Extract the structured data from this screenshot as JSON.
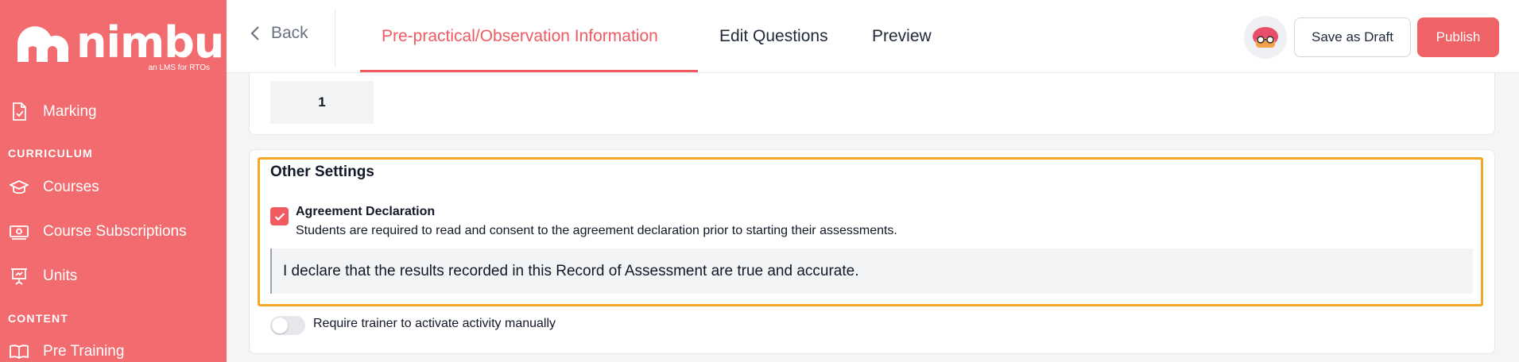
{
  "sidebar": {
    "logo_text": "nimbu",
    "logo_tagline": "an LMS for RTOs",
    "items_top": [
      {
        "label": "Marking",
        "icon": "document-check-icon"
      }
    ],
    "sections": [
      {
        "label": "CURRICULUM",
        "items": [
          {
            "label": "Courses",
            "icon": "graduation-cap-icon"
          },
          {
            "label": "Course Subscriptions",
            "icon": "money-icon"
          },
          {
            "label": "Units",
            "icon": "presentation-board-icon"
          }
        ]
      },
      {
        "label": "CONTENT",
        "items": [
          {
            "label": "Pre Training",
            "icon": "book-open-icon"
          }
        ]
      }
    ]
  },
  "header": {
    "back_label": "Back",
    "tabs": [
      {
        "label": "Pre-practical/Observation Information",
        "active": true
      },
      {
        "label": "Edit Questions",
        "active": false
      },
      {
        "label": "Preview",
        "active": false
      }
    ],
    "save_draft_label": "Save as Draft",
    "publish_label": "Publish"
  },
  "content": {
    "number_value": "1",
    "other_settings": {
      "title": "Other Settings",
      "agreement_title": "Agreement Declaration",
      "agreement_checked": true,
      "agreement_description": "Students are required to read and consent to the agreement declaration prior to starting their assessments.",
      "declaration_text": "I declare that the results recorded in this Record of Assessment are true and accurate.",
      "manual_activation_label": "Require trainer to activate activity manually",
      "manual_activation_enabled": false
    }
  },
  "colors": {
    "brand": "#f26b6e",
    "accent": "#ef5b61",
    "highlight": "#f5a623"
  }
}
